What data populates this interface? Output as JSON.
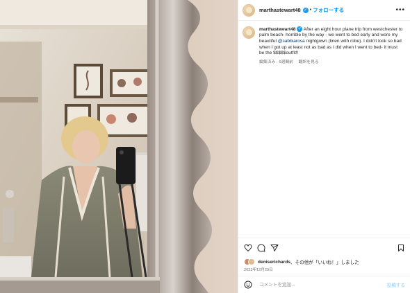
{
  "header": {
    "username": "marthastewart48",
    "separator": "•",
    "follow_label": "フォローする",
    "more_icon": "more-horizontal-icon"
  },
  "caption": {
    "username": "marthastewart48",
    "text_before": "After an eight hour plane trip from westchester to palm beach- horrible by the way - we went to bed early and wore my beautiful ",
    "mention": "@sabbiarosa",
    "text_after": " nightgown (linen with robe). I didn't look so bad when I got up at least not as bad as I did when I went to bed- it must be the $$$$$outfit!!",
    "edited": "編集済み · 6週間前",
    "translate": "翻訳を見る"
  },
  "actions": {
    "like_icon": "heart-icon",
    "comment_icon": "comment-icon",
    "share_icon": "paper-plane-icon",
    "save_icon": "bookmark-icon"
  },
  "likes": {
    "liker": "deniserichards",
    "suffix_prefix": "、その他",
    "suffix_mid": "が「いいね！」しました"
  },
  "date": "2023年12月29日",
  "comment_box": {
    "placeholder": "コメントを追加...",
    "post_label": "投稿する",
    "emoji_icon": "smiley-icon"
  },
  "colors": {
    "accent": "#0095f6",
    "verified": "#1d9bf0",
    "mention": "#00376b",
    "muted": "#737373"
  }
}
